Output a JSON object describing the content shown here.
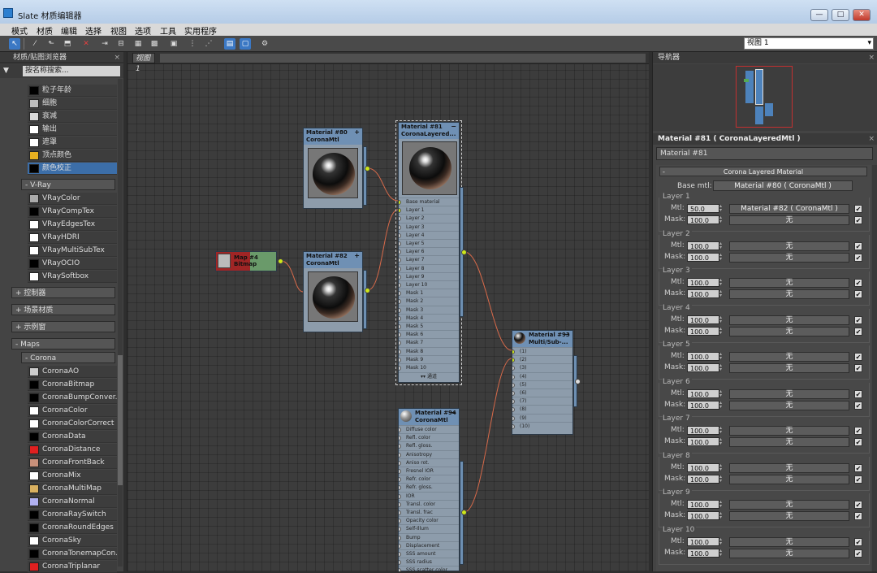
{
  "window": {
    "title": "Slate 材质编辑器",
    "min": "—",
    "max": "□",
    "close": "✕"
  },
  "menu": [
    "模式",
    "材质",
    "编辑",
    "选择",
    "视图",
    "选项",
    "工具",
    "实用程序"
  ],
  "toolbar": {
    "view_select": "视图 1"
  },
  "browser": {
    "title": "材质/贴图浏览器",
    "search_placeholder": "按名称搜索...",
    "top_items": [
      {
        "label": "粒子年龄",
        "color": "#000000"
      },
      {
        "label": "细胞",
        "color": "#bdbdbd"
      },
      {
        "label": "衰减",
        "color": "#d8d8d8"
      },
      {
        "label": "输出",
        "color": "#ffffff"
      },
      {
        "label": "遮罩",
        "color": "#ffffff"
      },
      {
        "label": "顶点颜色",
        "color": "#e8b020"
      },
      {
        "label": "颜色校正",
        "color": "#000000"
      }
    ],
    "vray_header": "- V-Ray",
    "vray_items": [
      {
        "label": "VRayColor",
        "color": "#aaaaaa"
      },
      {
        "label": "VRayCompTex",
        "color": "#000000"
      },
      {
        "label": "VRayEdgesTex",
        "color": "#ffffff"
      },
      {
        "label": "VRayHDRI",
        "color": "#ffffff"
      },
      {
        "label": "VRayMultiSubTex",
        "color": "#ffffff"
      },
      {
        "label": "VRayOCIO",
        "color": "#000000"
      },
      {
        "label": "VRaySoftbox",
        "color": "#ffffff"
      }
    ],
    "sections": [
      "+ 控制器",
      "+ 场景材质",
      "+ 示例窗"
    ],
    "maps_header": "- Maps",
    "corona_header": "- Corona",
    "corona_items": [
      {
        "label": "CoronaAO",
        "color": "#cccccc"
      },
      {
        "label": "CoronaBitmap",
        "color": "#000000"
      },
      {
        "label": "CoronaBumpConver...",
        "color": "#000000"
      },
      {
        "label": "CoronaColor",
        "color": "#ffffff"
      },
      {
        "label": "CoronaColorCorrect",
        "color": "#ffffff"
      },
      {
        "label": "CoronaData",
        "color": "#000000"
      },
      {
        "label": "CoronaDistance",
        "color": "#e02020"
      },
      {
        "label": "CoronaFrontBack",
        "color": "#c8907a"
      },
      {
        "label": "CoronaMix",
        "color": "#ffffff"
      },
      {
        "label": "CoronaMultiMap",
        "color": "#d9b060"
      },
      {
        "label": "CoronaNormal",
        "color": "#b0b0f0"
      },
      {
        "label": "CoronaRaySwitch",
        "color": "#000000"
      },
      {
        "label": "CoronaRoundEdges",
        "color": "#000000"
      },
      {
        "label": "CoronaSky",
        "color": "#ffffff"
      },
      {
        "label": "CoronaTonemapCon...",
        "color": "#000000"
      },
      {
        "label": "CoronaTriplanar",
        "color": "#e02020"
      }
    ]
  },
  "view": {
    "tab": "视图 1",
    "node80": {
      "title": "Material #80",
      "type": "CoronaMtl"
    },
    "node81": {
      "title": "Material #81",
      "type": "CoronaLayered...",
      "slots": [
        "Base material",
        "Layer 1",
        "Layer 2",
        "Layer 3",
        "Layer 4",
        "Layer 5",
        "Layer 6",
        "Layer 7",
        "Layer 8",
        "Layer 9",
        "Layer 10",
        "Mask 1",
        "Mask 2",
        "Mask 3",
        "Mask 4",
        "Mask 5",
        "Mask 6",
        "Mask 7",
        "Mask 8",
        "Mask 9",
        "Mask 10"
      ],
      "footer": "▾▾ 通道"
    },
    "node82": {
      "title": "Material #82",
      "type": "CoronaMtl"
    },
    "node93": {
      "title": "Material #93",
      "type": "Multi/Sub-...",
      "slots": [
        "(1)",
        "(2)",
        "(3)",
        "(4)",
        "(5)",
        "(6)",
        "(7)",
        "(8)",
        "(9)",
        "(10)"
      ]
    },
    "node94": {
      "title": "Material #94",
      "type": "CoronaMtl",
      "slots": [
        "Diffuse color",
        "Refl. color",
        "Refl. gloss.",
        "Anisotropy",
        "Aniso rot.",
        "Fresnel IOR",
        "Refr. color",
        "Refr. gloss.",
        "IOR",
        "Transl. color",
        "Transl. frac",
        "Opacity color",
        "Self-Illum",
        "Bump",
        "Displacement",
        "SSS amount",
        "SSS radius",
        "SSS scatter color"
      ]
    },
    "map4": {
      "title": "Map #4",
      "type": "Bitmap"
    }
  },
  "navigator": {
    "title": "导航器"
  },
  "props": {
    "title": "Material #81  ( CoronaLayeredMtl )",
    "name": "Material #81",
    "rollout": "Corona Layered Material",
    "base_label": "Base mtl:",
    "base_value": "Material #80  ( CoronaMtl )",
    "mtl_label": "Mtl:",
    "mask_label": "Mask:",
    "layers": [
      {
        "name": "Layer 1",
        "amount": "50.0",
        "mask": "100.0",
        "mtl": "Material #82  ( CoronaMtl )",
        "mtl_mask": "无"
      },
      {
        "name": "Layer 2",
        "amount": "100.0",
        "mask": "100.0",
        "mtl": "无",
        "mtl_mask": "无"
      },
      {
        "name": "Layer 3",
        "amount": "100.0",
        "mask": "100.0",
        "mtl": "无",
        "mtl_mask": "无"
      },
      {
        "name": "Layer 4",
        "amount": "100.0",
        "mask": "100.0",
        "mtl": "无",
        "mtl_mask": "无"
      },
      {
        "name": "Layer 5",
        "amount": "100.0",
        "mask": "100.0",
        "mtl": "无",
        "mtl_mask": "无"
      },
      {
        "name": "Layer 6",
        "amount": "100.0",
        "mask": "100.0",
        "mtl": "无",
        "mtl_mask": "无"
      },
      {
        "name": "Layer 7",
        "amount": "100.0",
        "mask": "100.0",
        "mtl": "无",
        "mtl_mask": "无"
      },
      {
        "name": "Layer 8",
        "amount": "100.0",
        "mask": "100.0",
        "mtl": "无",
        "mtl_mask": "无"
      },
      {
        "name": "Layer 9",
        "amount": "100.0",
        "mask": "100.0",
        "mtl": "无",
        "mtl_mask": "无"
      },
      {
        "name": "Layer 10",
        "amount": "100.0",
        "mask": "100.0",
        "mtl": "无",
        "mtl_mask": "无"
      }
    ]
  }
}
